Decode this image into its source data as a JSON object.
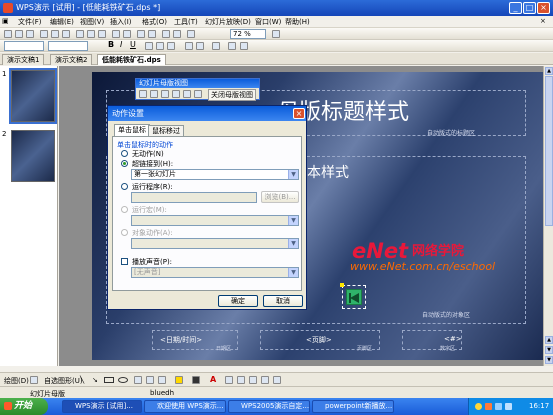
{
  "window": {
    "title": "WPS演示 [试用] - [低能耗铁矿石.dps *]"
  },
  "menu": [
    "文件(F)",
    "编辑(E)",
    "视图(V)",
    "插入(I)",
    "格式(O)",
    "工具(T)",
    "幻灯片放映(D)",
    "窗口(W)",
    "帮助(H)"
  ],
  "toolbar": {
    "zoom": "72 %"
  },
  "tabs": [
    "演示文稿1",
    "演示文稿2",
    "低能耗铁矿石.dps"
  ],
  "thumbnails": [
    {
      "num": "1"
    },
    {
      "num": "2"
    }
  ],
  "slide": {
    "title": "编辑母版标题样式",
    "title_partial": "母版标题样式",
    "body_partial": "本样式",
    "autolayout_title": "自动版式的标题区",
    "autolayout_object": "自动版式的对象区",
    "footer_date": "<日期/时间>",
    "footer_center": "<页脚>",
    "footer_num": "<#>",
    "footer_date_region": "日期区",
    "footer_region": "页脚区",
    "num_region": "数字区",
    "watermark_logo": "eNet",
    "watermark_school": "网络学院",
    "watermark_url": "www.eNet.com.cn/eschool"
  },
  "master_toolbar": {
    "title": "幻灯片母版视图",
    "close": "关闭母版视图"
  },
  "dialog": {
    "title": "动作设置",
    "tab_click": "单击鼠标",
    "tab_hover": "鼠标移过",
    "group_label": "单击鼠标时的动作",
    "opt_none": "无动作(N)",
    "opt_link": "超链接到(H):",
    "link_value": "第一张幻灯片",
    "opt_program": "运行程序(R):",
    "browse": "浏览(B)...",
    "opt_macro": "运行宏(M):",
    "opt_object": "对象动作(A):",
    "play_sound": "播放声音(P):",
    "sound_value": "[无声音]",
    "ok": "确定",
    "cancel": "取消"
  },
  "drawbar": {
    "draw": "绘图(D)",
    "autoshape": "自选图形(U)"
  },
  "status": {
    "left": "幻灯片母版",
    "center": "bluedh"
  },
  "taskbar": {
    "start": "开始",
    "items": [
      "WPS演示 [试用]...",
      "欢迎使用 WPS演示...",
      "WPS2005演示自定...",
      "powerpoint新播放..."
    ],
    "clock": "16:17"
  },
  "colors": {
    "titlebar": "#1e54c8",
    "slide_bg": "#3a4e7c",
    "taskbar": "#2568e0",
    "start": "#3a9e3a",
    "action_button": "#2fb36a"
  }
}
